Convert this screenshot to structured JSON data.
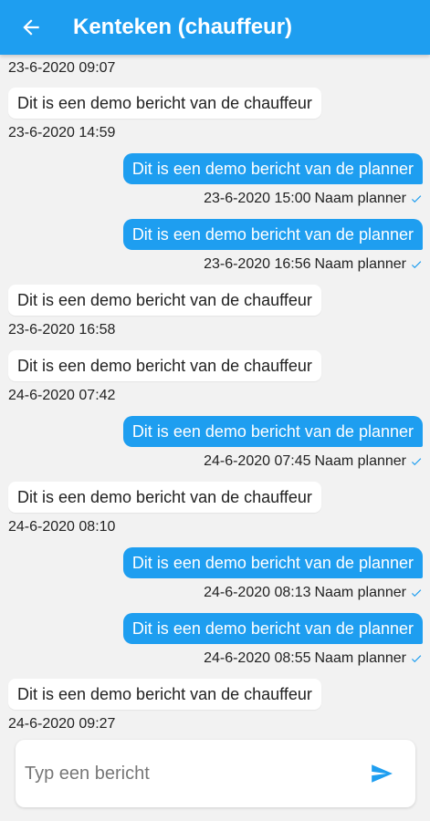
{
  "header": {
    "title": "Kenteken (chauffeur)",
    "back_icon": "arrow-left-icon",
    "background": "#1e9ef0"
  },
  "messages": [
    {
      "type": "meta-only",
      "time": "23-6-2020 09:07"
    },
    {
      "type": "in",
      "text": "Dit is een demo bericht van de chauffeur",
      "time": "23-6-2020 14:59"
    },
    {
      "type": "out",
      "text": "Dit is een demo bericht van de planner",
      "time": "23-6-2020 15:00",
      "sender": "Naam planner"
    },
    {
      "type": "out",
      "text": "Dit is een demo bericht van de planner",
      "time": "23-6-2020 16:56",
      "sender": "Naam planner"
    },
    {
      "type": "in",
      "text": "Dit is een demo bericht van de chauffeur",
      "time": "23-6-2020 16:58"
    },
    {
      "type": "in",
      "text": "Dit is een demo bericht van de chauffeur",
      "time": "24-6-2020 07:42"
    },
    {
      "type": "out",
      "text": "Dit is een demo bericht van de planner",
      "time": "24-6-2020 07:45",
      "sender": "Naam planner"
    },
    {
      "type": "in",
      "text": "Dit is een demo bericht van de chauffeur",
      "time": "24-6-2020 08:10"
    },
    {
      "type": "out",
      "text": "Dit is een demo bericht van de planner",
      "time": "24-6-2020 08:13",
      "sender": "Naam planner"
    },
    {
      "type": "out",
      "text": "Dit is een demo bericht van de planner",
      "time": "24-6-2020 08:55",
      "sender": "Naam planner"
    },
    {
      "type": "in",
      "text": "Dit is een demo bericht van de chauffeur",
      "time": "24-6-2020 09:27"
    }
  ],
  "composer": {
    "placeholder": "Typ een bericht",
    "value": "",
    "send_icon": "send-icon"
  },
  "colors": {
    "accent": "#1e9ef0",
    "background": "#f2f2f2",
    "incoming_bubble": "#ffffff"
  }
}
